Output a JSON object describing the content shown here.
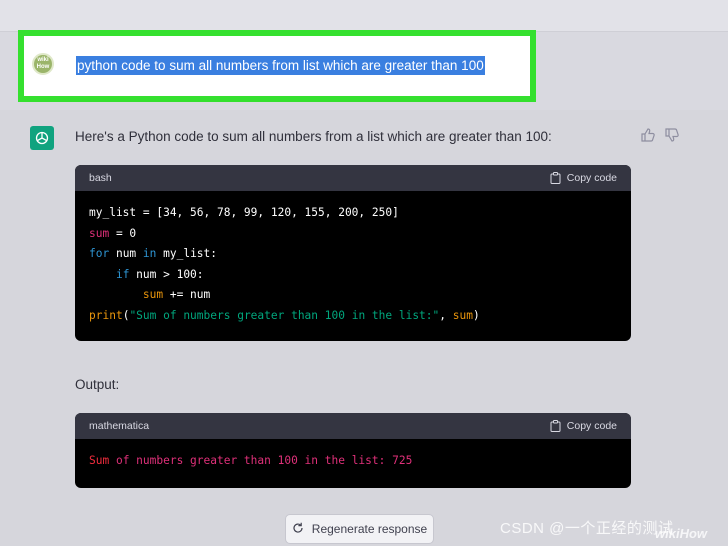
{
  "user_message": {
    "avatar_text": "wiki How",
    "text": "python code to sum all numbers from list which are greater than 100"
  },
  "assistant": {
    "intro": "Here's a Python code to sum all numbers from a list which are greater than 100:",
    "output_label": "Output:",
    "code_blocks": [
      {
        "language": "bash",
        "copy_label": "Copy code"
      },
      {
        "language": "mathematica",
        "copy_label": "Copy code"
      }
    ]
  },
  "regenerate_label": "Regenerate response",
  "watermark": "CSDN @一个正经的测试",
  "wikihow_mark": "wikiHow",
  "colors": {
    "highlight_frame": "#35e02f",
    "selection": "#3a7fe0",
    "gpt_brand": "#10a37f"
  }
}
